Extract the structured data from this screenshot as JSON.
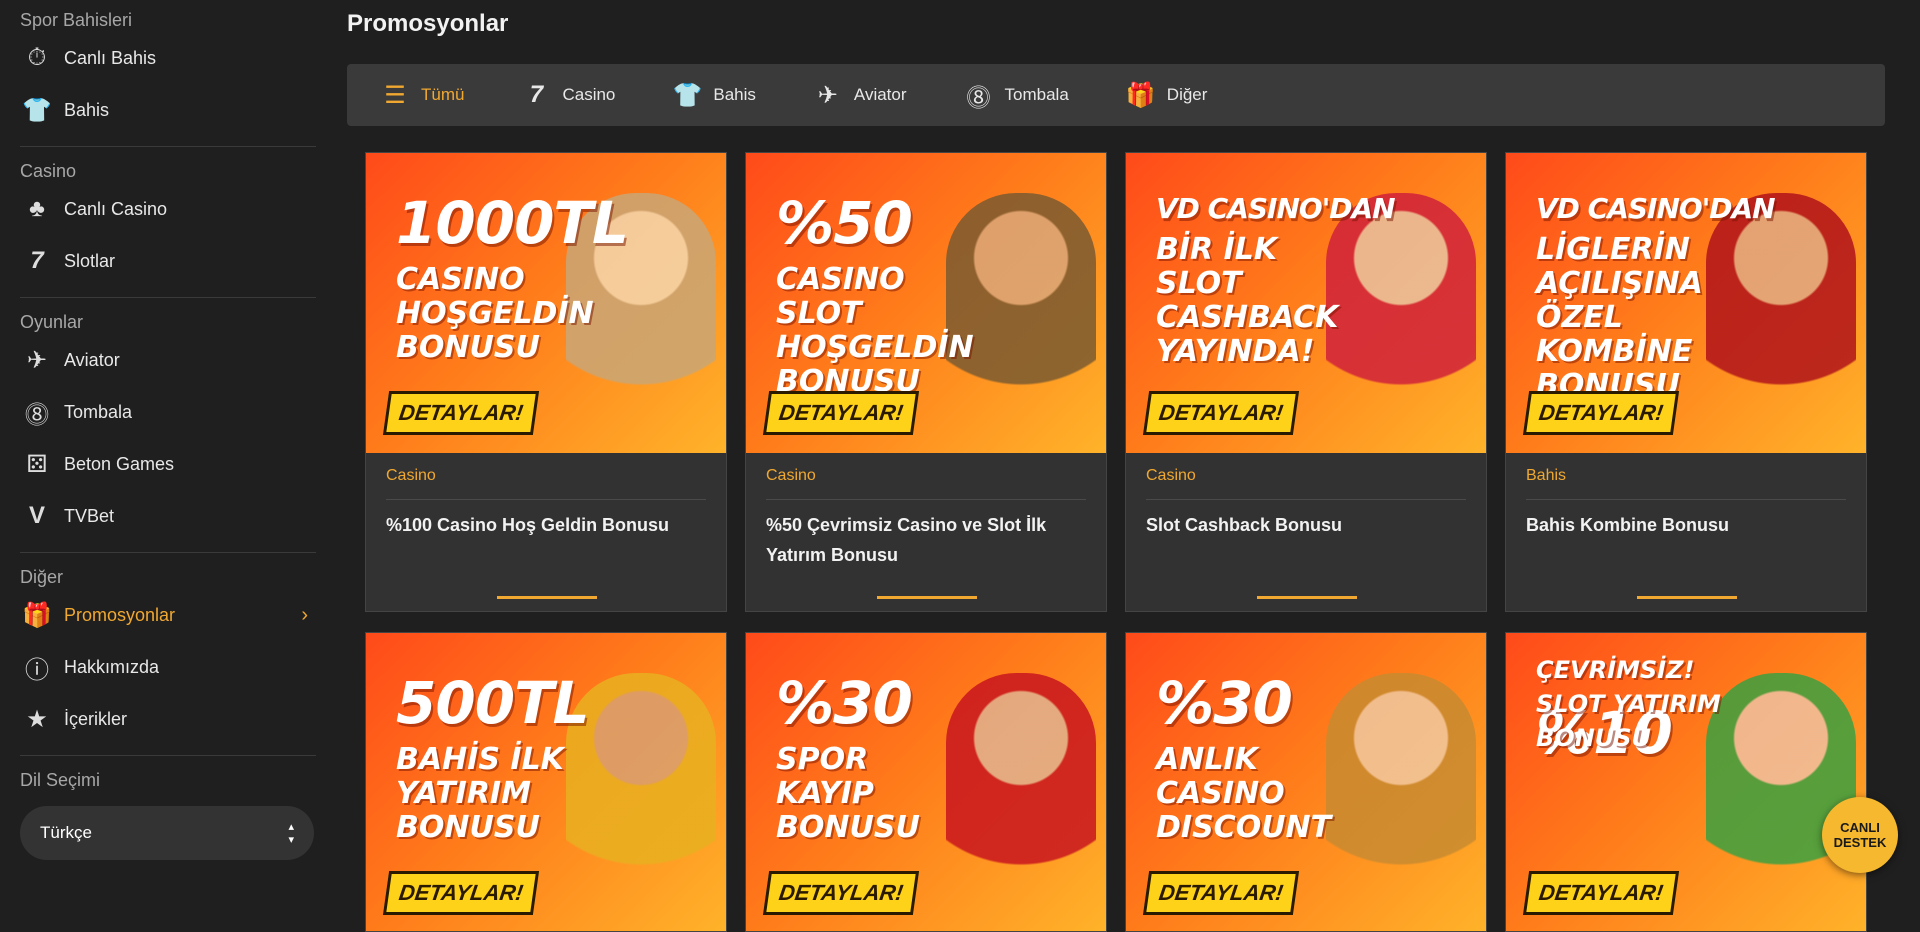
{
  "sidebar": {
    "sections": [
      {
        "title": "Spor Bahisleri",
        "items": [
          {
            "label": "Canlı Bahis",
            "icon": "stopwatch-icon"
          },
          {
            "label": "Bahis",
            "icon": "jersey-icon"
          }
        ]
      },
      {
        "title": "Casino",
        "items": [
          {
            "label": "Canlı Casino",
            "icon": "club-icon"
          },
          {
            "label": "Slotlar",
            "icon": "seven-icon"
          }
        ]
      },
      {
        "title": "Oyunlar",
        "items": [
          {
            "label": "Aviator",
            "icon": "propeller-icon"
          },
          {
            "label": "Tombala",
            "icon": "bingo-ball-icon"
          },
          {
            "label": "Beton Games",
            "icon": "dice-icon"
          },
          {
            "label": "TVBet",
            "icon": "tvbet-icon"
          }
        ]
      },
      {
        "title": "Diğer",
        "items": [
          {
            "label": "Promosyonlar",
            "icon": "gift-icon",
            "active": true
          },
          {
            "label": "Hakkımızda",
            "icon": "info-icon"
          },
          {
            "label": "İçerikler",
            "icon": "star-icon"
          }
        ]
      }
    ],
    "language_title": "Dil Seçimi",
    "language_value": "Türkçe"
  },
  "main": {
    "title": "Promosyonlar",
    "tabs": [
      {
        "label": "Tümü",
        "icon": "list-icon",
        "active": true
      },
      {
        "label": "Casino",
        "icon": "seven-icon"
      },
      {
        "label": "Bahis",
        "icon": "jersey-icon"
      },
      {
        "label": "Aviator",
        "icon": "propeller-icon"
      },
      {
        "label": "Tombala",
        "icon": "bingo-ball-icon"
      },
      {
        "label": "Diğer",
        "icon": "gift-icon"
      }
    ],
    "cards": [
      {
        "big": "1000TL",
        "sub": "CASINO HOŞGELDİN BONUSU",
        "button": "DETAYLAR!",
        "category": "Casino",
        "title": "%100 Casino Hoş Geldin Bonusu"
      },
      {
        "big": "%50",
        "sub": "CASINO SLOT HOŞGELDİN BONUSU",
        "button": "DETAYLAR!",
        "category": "Casino",
        "title": "%50 Çevrimsiz Casino ve Slot İlk Yatırım Bonusu"
      },
      {
        "big": "VD CASINO'DAN",
        "sub": "BİR İLK SLOT CASHBACK YAYINDA!",
        "button": "DETAYLAR!",
        "category": "Casino",
        "title": "Slot Cashback Bonusu"
      },
      {
        "big": "VD CASINO'DAN",
        "sub": "LİGLERİN AÇILIŞINA ÖZEL KOMBİNE BONUSU",
        "button": "DETAYLAR!",
        "category": "Bahis",
        "title": "Bahis Kombine Bonusu"
      },
      {
        "big": "500TL",
        "sub": "BAHİS İLK YATIRIM BONUSU",
        "button": "DETAYLAR!"
      },
      {
        "big": "%30",
        "sub": "SPOR KAYIP BONUSU",
        "button": "DETAYLAR!"
      },
      {
        "big": "%30",
        "sub": "ANLIK CASINO DISCOUNT",
        "button": "DETAYLAR!"
      },
      {
        "big": "%10",
        "sub": "ÇEVRİMSİZ! SLOT YATIRIM BONUSU",
        "button": "DETAYLAR!"
      }
    ]
  },
  "live_support": {
    "line1": "CANLI",
    "line2": "DESTEK"
  },
  "colors": {
    "accent": "#f0a830",
    "background": "#1f1f1f",
    "card": "#323232"
  }
}
